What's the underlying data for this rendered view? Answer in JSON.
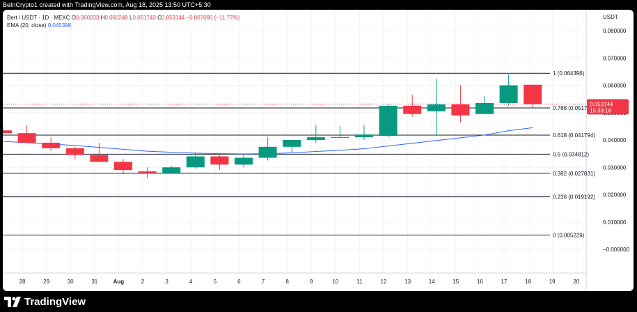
{
  "caption": "BeInCrypto1 created with TradingView.com, Aug 18, 2025 13:50 UTC+5:30",
  "legend": {
    "symbol": "Bert / USDT · 1D · MEXC",
    "o_label": "O",
    "o_value": "0.060233",
    "h_label": "H",
    "h_value": "0.060248",
    "l_label": "L",
    "l_value": "0.051743",
    "c_label": "C",
    "c_value": "0.053144",
    "change": "−0.007090 (−11.77%)",
    "ema_label": "EMA (20, close)",
    "ema_value": "0.045398"
  },
  "axis": {
    "currency": "USDT",
    "price_tag": "0.053144",
    "countdown": "15:39:16"
  },
  "footer": {
    "brand": "TradingView"
  },
  "colors": {
    "up": "#089981",
    "down": "#f23645",
    "ema": "#2962ff",
    "fib": "#131722",
    "grid": "#f0f3fa"
  },
  "chart_data": {
    "type": "candlestick",
    "y_ticks": [
      "0.080000",
      "0.070000",
      "0.060000",
      "0.050000",
      "0.040000",
      "0.030000",
      "0.020000",
      "0.010000",
      "−0.000000"
    ],
    "ylim": [
      -0.004,
      0.09
    ],
    "x_ticks": [
      "28",
      "29",
      "30",
      "31",
      "Aug",
      "2",
      "3",
      "4",
      "5",
      "6",
      "7",
      "8",
      "9",
      "10",
      "11",
      "12",
      "13",
      "14",
      "15",
      "16",
      "17",
      "18",
      "19",
      "20"
    ],
    "candles": [
      {
        "o": 0.0435,
        "h": 0.045,
        "l": 0.0415,
        "c": 0.0425
      },
      {
        "o": 0.0425,
        "h": 0.0455,
        "l": 0.039,
        "c": 0.039
      },
      {
        "o": 0.039,
        "h": 0.041,
        "l": 0.036,
        "c": 0.037
      },
      {
        "o": 0.037,
        "h": 0.0375,
        "l": 0.033,
        "c": 0.0345
      },
      {
        "o": 0.0345,
        "h": 0.039,
        "l": 0.032,
        "c": 0.032
      },
      {
        "o": 0.032,
        "h": 0.033,
        "l": 0.0275,
        "c": 0.029
      },
      {
        "o": 0.0285,
        "h": 0.03,
        "l": 0.026,
        "c": 0.028
      },
      {
        "o": 0.028,
        "h": 0.0305,
        "l": 0.0275,
        "c": 0.03
      },
      {
        "o": 0.03,
        "h": 0.0355,
        "l": 0.0295,
        "c": 0.034
      },
      {
        "o": 0.034,
        "h": 0.0345,
        "l": 0.029,
        "c": 0.031
      },
      {
        "o": 0.031,
        "h": 0.0345,
        "l": 0.03,
        "c": 0.0335
      },
      {
        "o": 0.0335,
        "h": 0.041,
        "l": 0.0325,
        "c": 0.0375
      },
      {
        "o": 0.0375,
        "h": 0.04,
        "l": 0.0355,
        "c": 0.04
      },
      {
        "o": 0.04,
        "h": 0.0455,
        "l": 0.039,
        "c": 0.041
      },
      {
        "o": 0.041,
        "h": 0.045,
        "l": 0.041,
        "c": 0.041
      },
      {
        "o": 0.041,
        "h": 0.0455,
        "l": 0.04,
        "c": 0.042
      },
      {
        "o": 0.0415,
        "h": 0.053,
        "l": 0.041,
        "c": 0.0525
      },
      {
        "o": 0.0525,
        "h": 0.0565,
        "l": 0.0485,
        "c": 0.0495
      },
      {
        "o": 0.0505,
        "h": 0.0625,
        "l": 0.0415,
        "c": 0.053
      },
      {
        "o": 0.053,
        "h": 0.06,
        "l": 0.0465,
        "c": 0.049
      },
      {
        "o": 0.0495,
        "h": 0.056,
        "l": 0.0495,
        "c": 0.0535
      },
      {
        "o": 0.0535,
        "h": 0.064,
        "l": 0.0525,
        "c": 0.06
      },
      {
        "o": 0.0602,
        "h": 0.0602,
        "l": 0.0517,
        "c": 0.0531
      }
    ],
    "ema": [
      0.0395,
      0.039,
      0.0385,
      0.038,
      0.0373,
      0.0366,
      0.0359,
      0.0355,
      0.0352,
      0.035,
      0.0349,
      0.035,
      0.0353,
      0.0358,
      0.0362,
      0.0368,
      0.0378,
      0.0388,
      0.0398,
      0.0408,
      0.0418,
      0.0434,
      0.0445
    ],
    "fib_levels": [
      {
        "label": "1 (0.064396)",
        "value": 0.064396
      },
      {
        "label": "0.786 (0.051734)",
        "value": 0.051734
      },
      {
        "label": "0.618 (0.041794)",
        "value": 0.041794
      },
      {
        "label": "0.5 (0.034812)",
        "value": 0.034812
      },
      {
        "label": "0.382 (0.027831)",
        "value": 0.027831
      },
      {
        "label": "0.236 (0.019192)",
        "value": 0.019192
      },
      {
        "label": "0 (0.005229)",
        "value": 0.005229
      }
    ],
    "last_price": 0.053144
  }
}
